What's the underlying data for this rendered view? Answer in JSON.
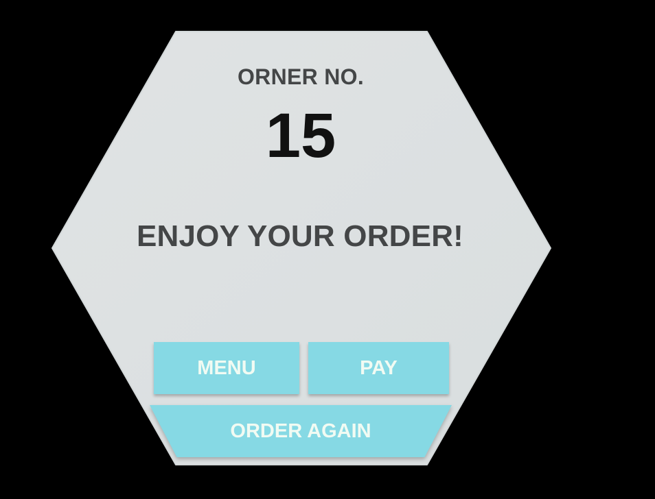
{
  "colors": {
    "background": "#000000",
    "panel": "#dde1e2",
    "heading_text": "#444647",
    "number_text": "#111111",
    "button_fill": "#86d9e4",
    "button_text": "#f1fbf3"
  },
  "order": {
    "label": "ORNER NO.",
    "number": "15"
  },
  "message": "ENJOY YOUR ORDER!",
  "buttons": {
    "menu": "MENU",
    "pay": "PAY",
    "order_again": "ORDER AGAIN"
  }
}
